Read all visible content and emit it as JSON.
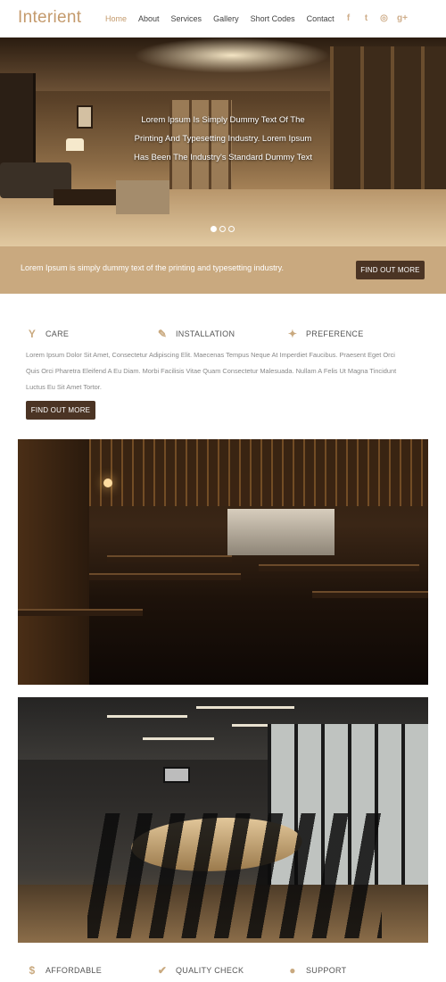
{
  "header": {
    "logo": "Interient",
    "nav": [
      "Home",
      "About",
      "Services",
      "Gallery",
      "Short Codes",
      "Contact"
    ],
    "active_nav": "Home",
    "social": [
      {
        "icon": "facebook-icon",
        "glyph": "f"
      },
      {
        "icon": "twitter-icon",
        "glyph": "t"
      },
      {
        "icon": "instagram-icon",
        "glyph": "◎"
      },
      {
        "icon": "google-plus-icon",
        "glyph": "g+"
      }
    ]
  },
  "hero": {
    "caption_lines": [
      "Lorem Ipsum Is Simply Dummy Text Of The",
      "Printing And Typesetting Industry. Lorem Ipsum",
      "Has Been The Industry's Standard Dummy Text"
    ],
    "slides": 3,
    "active_slide": 1
  },
  "band": {
    "text": "Lorem Ipsum is simply dummy text of the printing and typesetting industry.",
    "button": "Find out more"
  },
  "features": {
    "items": [
      {
        "icon": "cocktail-glass-icon",
        "glyph": "Y",
        "label": "Care"
      },
      {
        "icon": "wrench-icon",
        "glyph": "✎",
        "label": "Installation"
      },
      {
        "icon": "pin-icon",
        "glyph": "✦",
        "label": "Preference"
      }
    ],
    "paragraph": "Lorem Ipsum Dolor Sit Amet, Consectetur Adipiscing Elit. Maecenas Tempus Neque At Imperdiet Faucibus. Praesent Eget Orci Quis Orci Pharetra Eleifend A Eu Diam. Morbi Facilisis Vitae Quam Consectetur Malesuada. Nullam A Felis Ut Magna Tincidunt Luctus Eu Sit Amet Tortor.",
    "button": "Find out more"
  },
  "features_bottom": [
    {
      "icon": "dollar-icon",
      "glyph": "$",
      "label": "Affordable"
    },
    {
      "icon": "check-icon",
      "glyph": "✔",
      "label": "Quality check"
    },
    {
      "icon": "user-icon",
      "glyph": "●",
      "label": "Support"
    }
  ],
  "colors": {
    "accent": "#c49a6c",
    "band": "#c9a97f",
    "button": "#4b3424"
  }
}
